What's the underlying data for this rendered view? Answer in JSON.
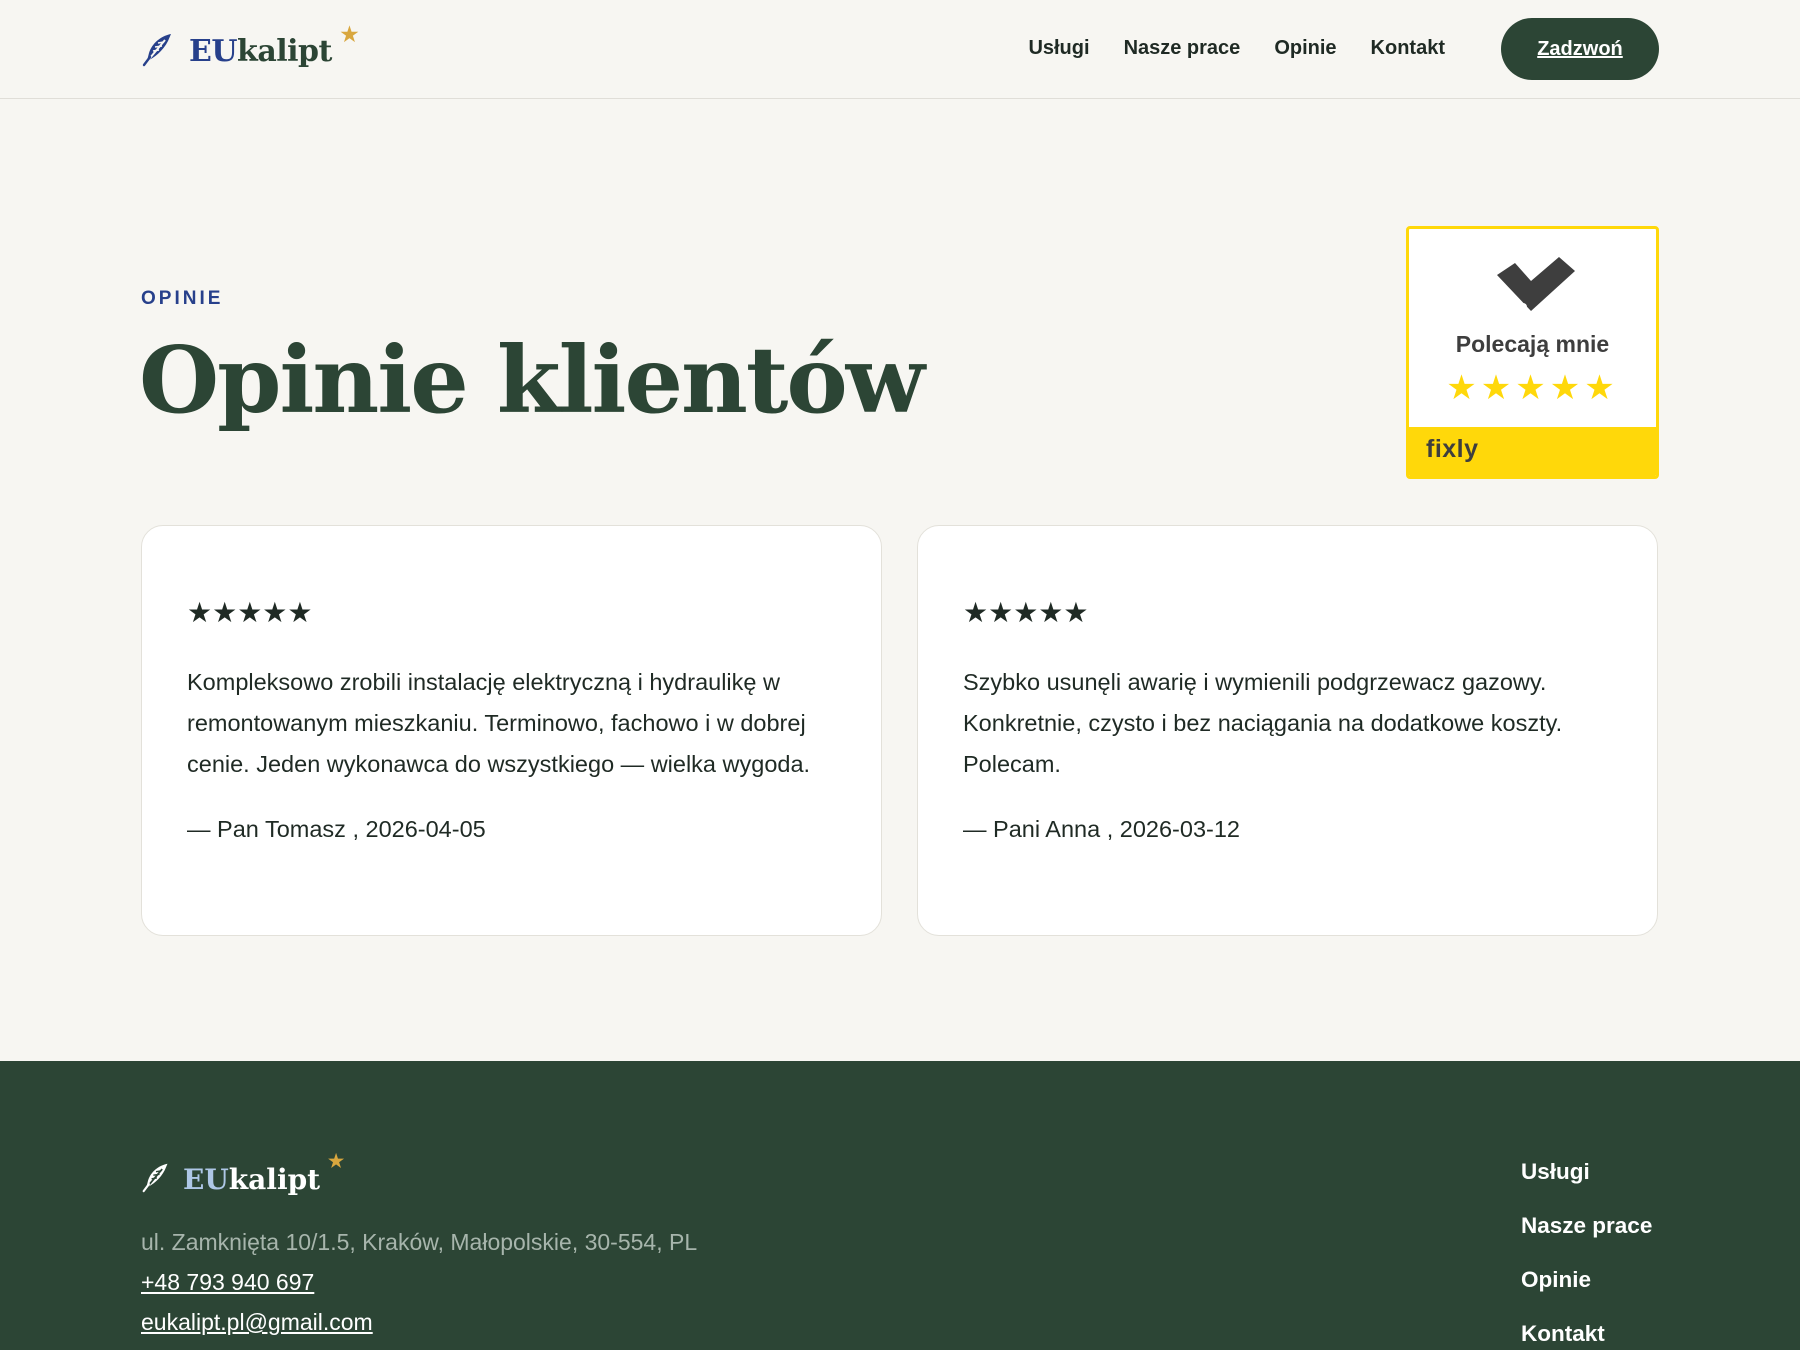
{
  "brand": {
    "name_part1": "EU",
    "name_part2": "kalipt",
    "star": "★",
    "icon": "feather-icon",
    "colors": {
      "primary_green": "#2c4535",
      "accent_blue": "#27408b",
      "star_gold": "#d9a73e"
    }
  },
  "nav": {
    "items": [
      "Usługi",
      "Nasze prace",
      "Opinie",
      "Kontakt"
    ],
    "cta_label": "Zadzwoń"
  },
  "section": {
    "eyebrow": "OPINIE",
    "title": "Opinie klientów"
  },
  "badge": {
    "title": "Polecają mnie",
    "stars": "★★★★★",
    "brand": "fixly",
    "icon": "check-tool-icon",
    "color": "#ffd80a"
  },
  "reviews": [
    {
      "stars": "★★★★★",
      "text": "Kompleksowo zrobili instalację elektryczną i hydraulikę w remontowanym mieszkaniu. Terminowo, fachowo i w dobrej cenie. Jeden wykonawca do wszystkiego — wielka wygoda.",
      "author": "— Pan Tomasz , 2026-04-05"
    },
    {
      "stars": "★★★★★",
      "text": "Szybko usunęli awarię i wymienili podgrzewacz gazowy. Konkretnie, czysto i bez naciągania na dodatkowe koszty. Polecam.",
      "author": "— Pani Anna , 2026-03-12"
    }
  ],
  "footer": {
    "address": "ul. Zamknięta 10/1.5, Kraków, Małopolskie, 30-554, PL",
    "phone": "+48 793 940 697",
    "email": "eukalipt.pl@gmail.com",
    "nav": [
      "Usługi",
      "Nasze prace",
      "Opinie",
      "Kontakt"
    ]
  }
}
